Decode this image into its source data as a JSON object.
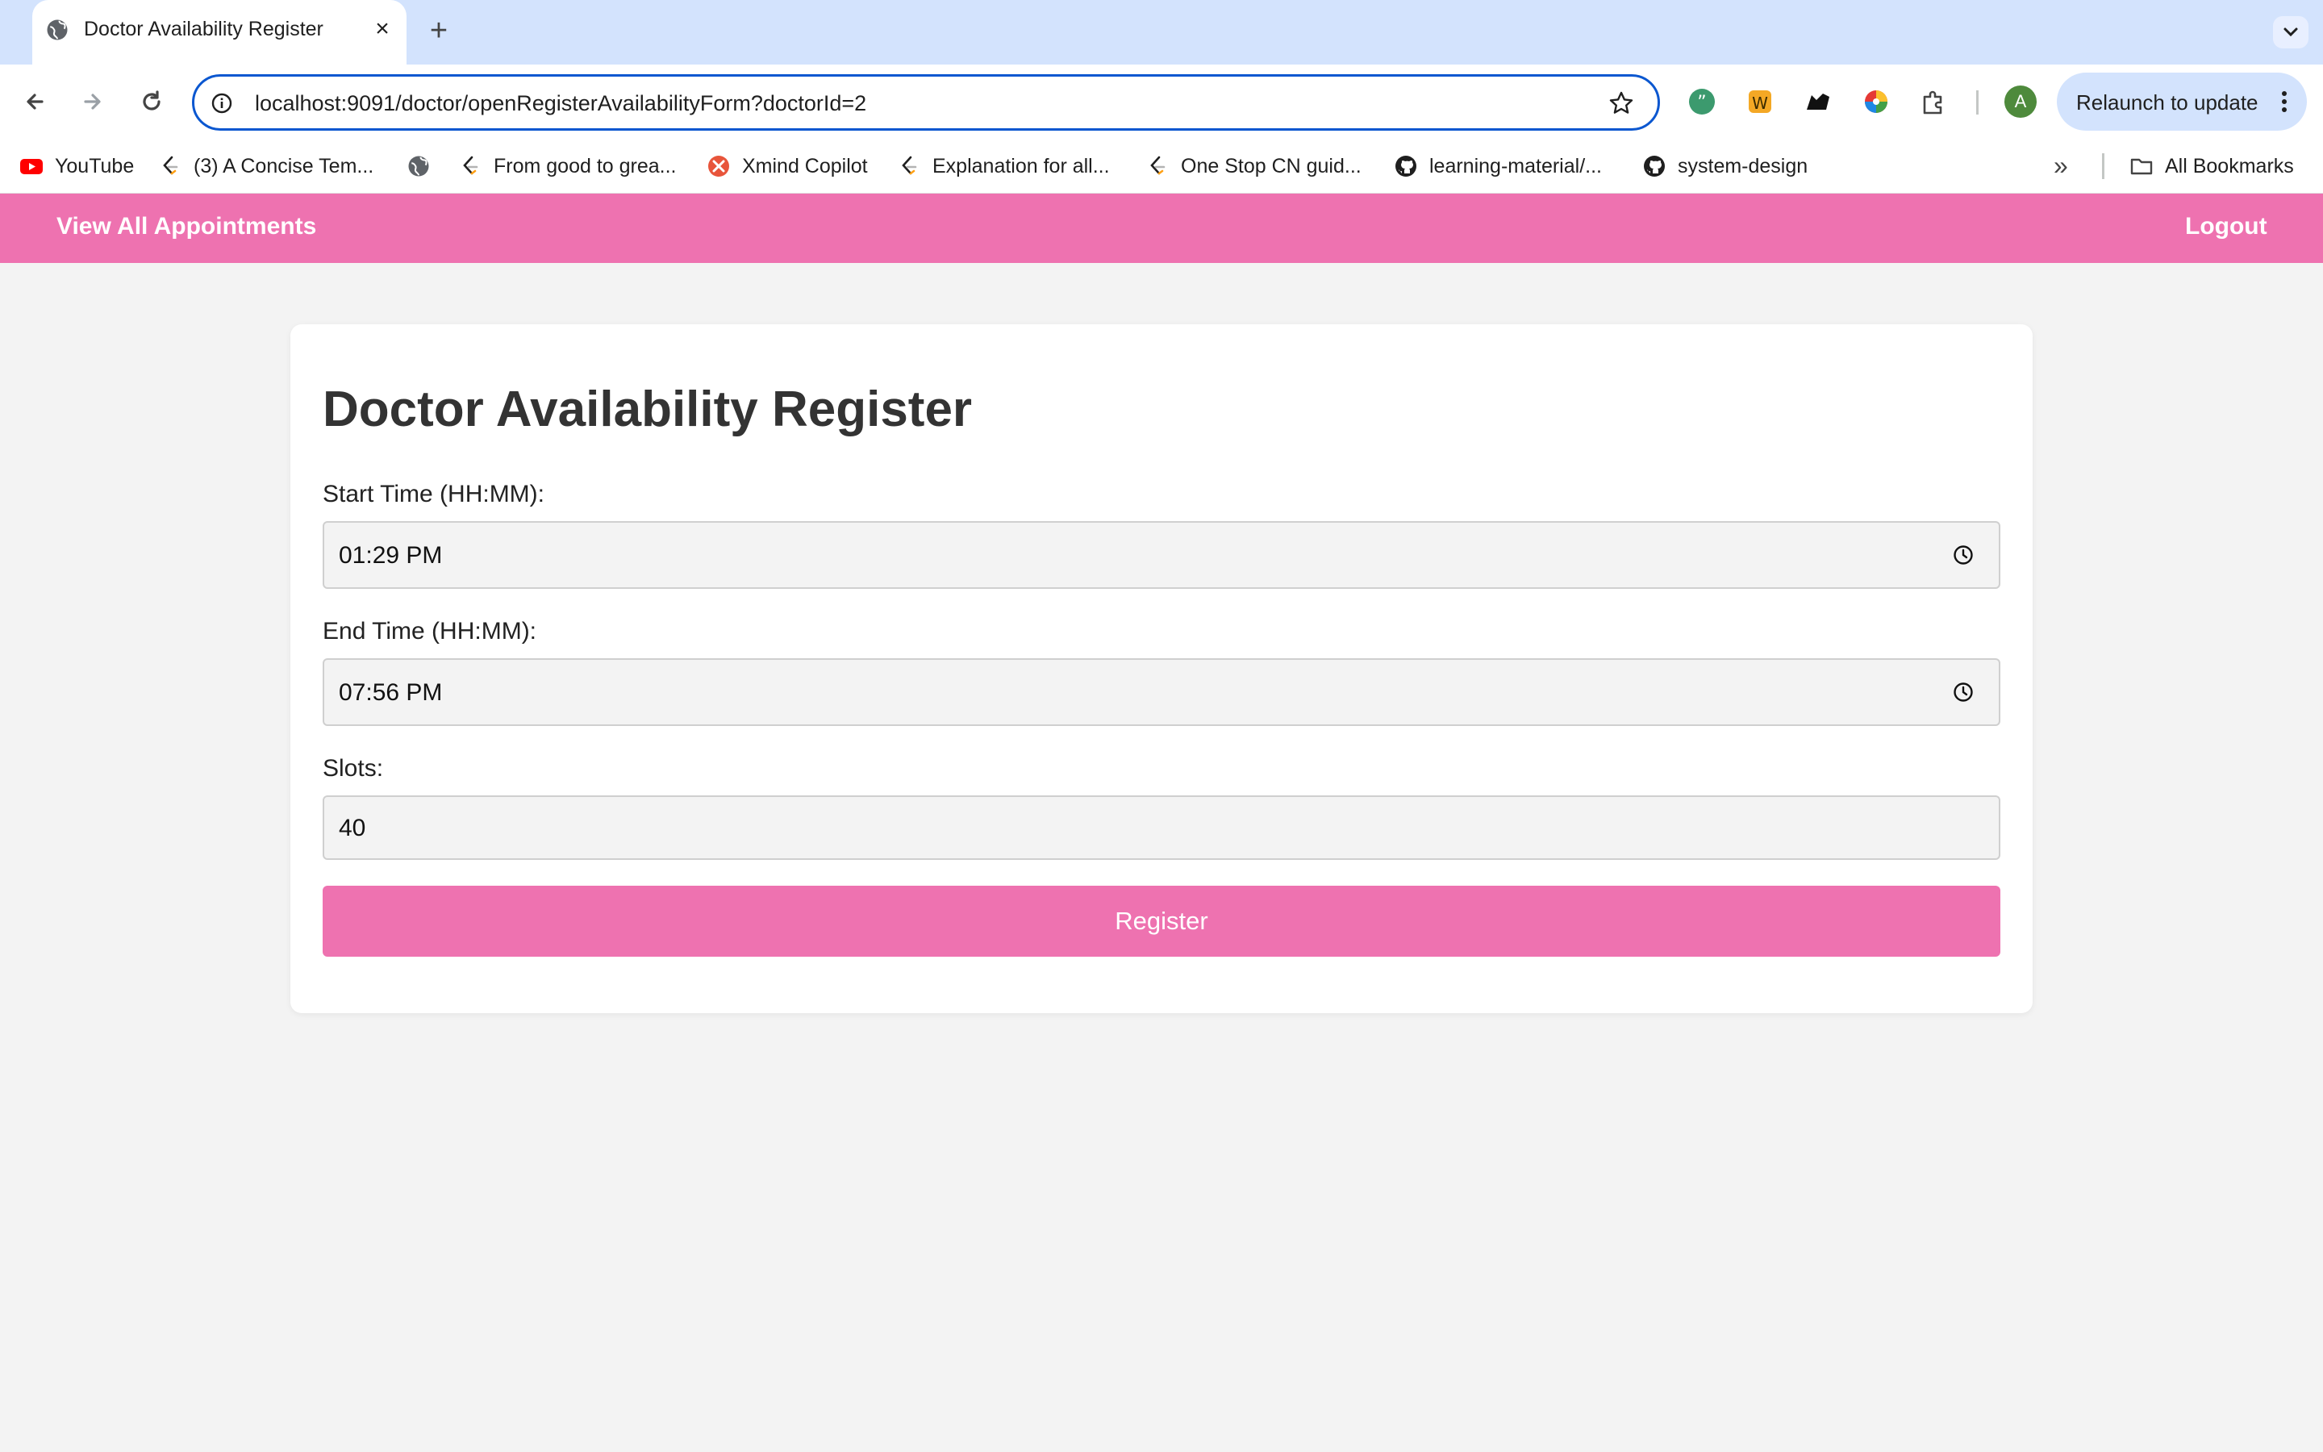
{
  "browser": {
    "tab_title": "Doctor Availability Register",
    "url": "localhost:9091/doctor/openRegisterAvailabilityForm?doctorId=2",
    "avatar_initial": "A",
    "relaunch_label": "Relaunch to update",
    "bookmarks": [
      {
        "label": "YouTube",
        "icon": "youtube-icon"
      },
      {
        "label": "(3) A Concise Tem...",
        "icon": "leetcode-icon"
      },
      {
        "label": "",
        "icon": "globe-icon"
      },
      {
        "label": "From good to grea...",
        "icon": "leetcode-icon"
      },
      {
        "label": "Xmind Copilot",
        "icon": "xmind-icon"
      },
      {
        "label": "Explanation for all...",
        "icon": "leetcode-icon"
      },
      {
        "label": "One Stop CN guid...",
        "icon": "leetcode-icon"
      },
      {
        "label": "learning-material/...",
        "icon": "github-icon"
      },
      {
        "label": "system-design",
        "icon": "github-icon"
      }
    ],
    "all_bookmarks_label": "All Bookmarks"
  },
  "nav": {
    "view_all_label": "View All Appointments",
    "logout_label": "Logout"
  },
  "form": {
    "title": "Doctor Availability Register",
    "start_label": "Start Time (HH:MM):",
    "start_value": "01:29 PM",
    "end_label": "End Time (HH:MM):",
    "end_value": "07:56 PM",
    "slots_label": "Slots:",
    "slots_value": "40",
    "register_label": "Register"
  },
  "colors": {
    "accent_pink": "#ee72b0",
    "tabstrip": "#d3e3fd",
    "omnibox_border": "#0b57d0"
  }
}
